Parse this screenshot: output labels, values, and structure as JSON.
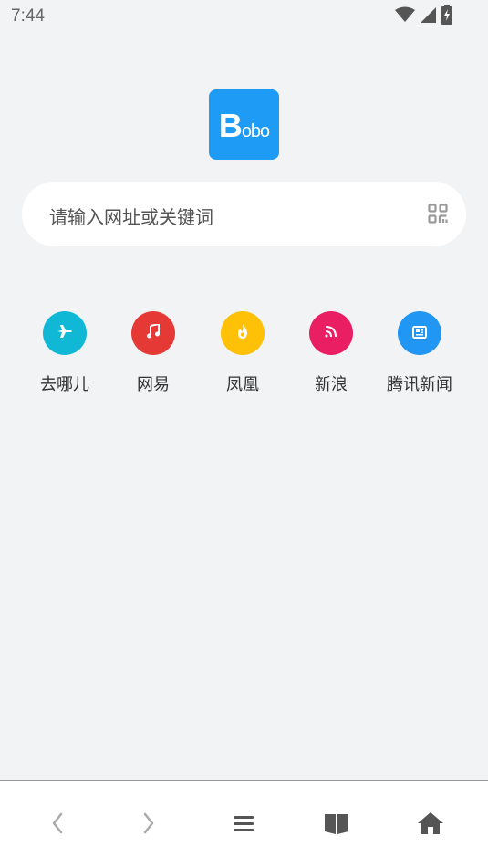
{
  "status_bar": {
    "time": "7:44",
    "icons": [
      "wifi-icon",
      "cellular-signal-icon",
      "battery-charging-icon"
    ]
  },
  "logo": {
    "letter": "B",
    "rest": "obo"
  },
  "search": {
    "placeholder": "请输入网址或关键词",
    "qr_icon": "qr-code-icon"
  },
  "shortcuts": [
    {
      "label": "去哪儿",
      "icon": "airplane-icon",
      "color": "#11b8d6"
    },
    {
      "label": "网易",
      "icon": "music-note-icon",
      "color": "#e53935"
    },
    {
      "label": "凤凰",
      "icon": "flame-icon",
      "color": "#ffc107"
    },
    {
      "label": "新浪",
      "icon": "rss-icon",
      "color": "#e91e63"
    },
    {
      "label": "腾讯新闻",
      "icon": "newspaper-icon",
      "color": "#2196f3"
    }
  ],
  "bottom_nav": [
    {
      "name": "back",
      "icon": "chevron-left-icon"
    },
    {
      "name": "forward",
      "icon": "chevron-right-icon"
    },
    {
      "name": "menu",
      "icon": "menu-icon"
    },
    {
      "name": "bookmarks",
      "icon": "book-icon"
    },
    {
      "name": "home",
      "icon": "home-icon"
    }
  ],
  "colors": {
    "background": "#f2f3f5",
    "logo": "#1e9bf5",
    "nav_icon_active": "#555555",
    "nav_icon_disabled": "#aaaaaa"
  }
}
